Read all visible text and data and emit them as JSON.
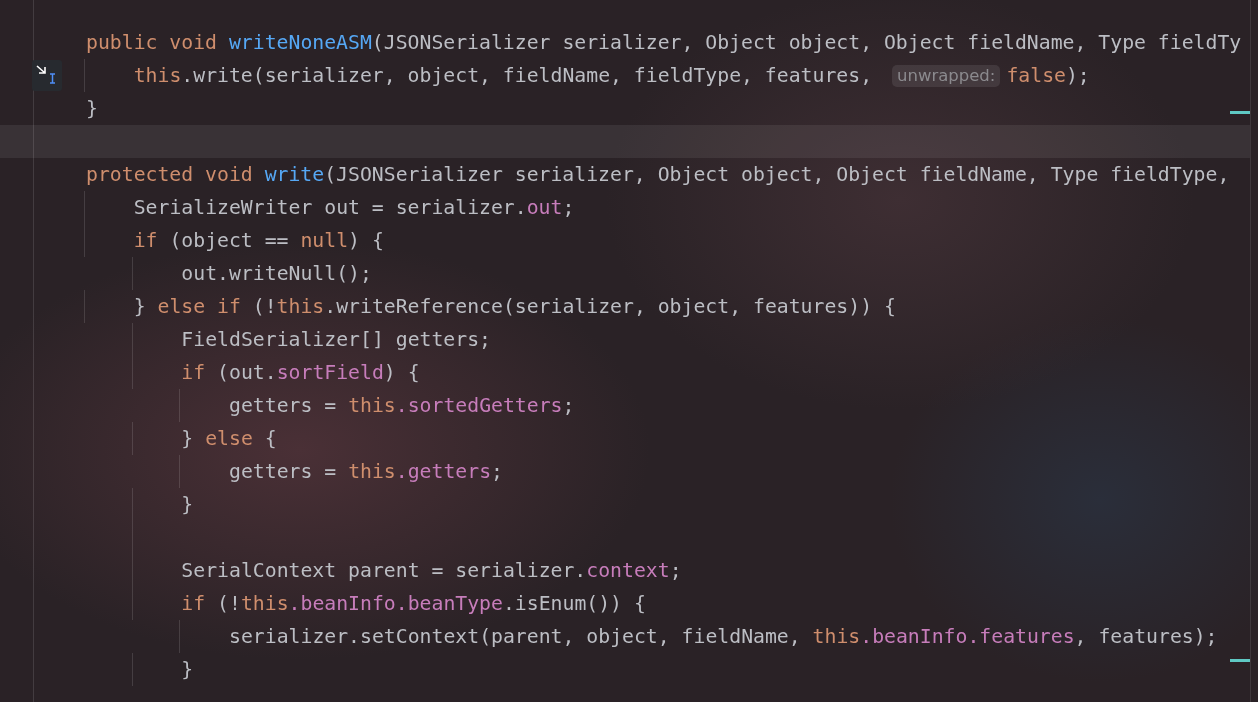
{
  "editor": {
    "lines": [
      {
        "current": false,
        "parts": [
          {
            "kind": "code",
            "tokens": [
              {
                "text": "public void ",
                "kind": "keyword"
              },
              {
                "text": "writeNoneASM",
                "kind": "method"
              },
              {
                "text": "(JSONSerializer serializer, Object object, Object fieldName, Type fieldTy",
                "kind": "plain"
              }
            ]
          }
        ],
        "children": [
          {
            "current": false,
            "gutter_icon": true,
            "parts": [
              {
                "kind": "code",
                "tokens": [
                  {
                    "text": "this",
                    "kind": "keyword"
                  },
                  {
                    "text": ".write(serializer, object, fieldName, fieldType, features, ",
                    "kind": "plain"
                  }
                ]
              },
              {
                "kind": "hint",
                "text": "unwrapped:"
              },
              {
                "kind": "code",
                "tokens": [
                  {
                    "text": "false",
                    "kind": "keyword"
                  },
                  {
                    "text": ");",
                    "kind": "plain"
                  }
                ]
              }
            ]
          }
        ]
      },
      {
        "current": false,
        "parts": [
          {
            "kind": "code",
            "tokens": [
              {
                "text": "}",
                "kind": "plain"
              }
            ]
          }
        ]
      },
      {
        "current": true
      },
      {
        "current": false,
        "parts": [
          {
            "kind": "code",
            "tokens": [
              {
                "text": "protected void ",
                "kind": "keyword"
              },
              {
                "text": "write",
                "kind": "method"
              },
              {
                "text": "(JSONSerializer serializer, Object object, Object fieldName, Type fieldType,",
                "kind": "plain"
              }
            ]
          }
        ],
        "children": [
          {
            "current": false,
            "parts": [
              {
                "kind": "code",
                "tokens": [
                  {
                    "text": "SerializeWriter out = serializer.",
                    "kind": "plain"
                  },
                  {
                    "text": "out",
                    "kind": "field"
                  },
                  {
                    "text": ";",
                    "kind": "plain"
                  }
                ]
              }
            ]
          },
          {
            "current": false,
            "parts": [
              {
                "kind": "code",
                "tokens": [
                  {
                    "text": "if",
                    "kind": "keyword"
                  },
                  {
                    "text": " (object == ",
                    "kind": "plain"
                  },
                  {
                    "text": "null",
                    "kind": "keyword"
                  },
                  {
                    "text": ") {",
                    "kind": "plain"
                  }
                ]
              }
            ],
            "children": [
              {
                "current": false,
                "parts": [
                  {
                    "kind": "code",
                    "tokens": [
                      {
                        "text": "out.writeNull();",
                        "kind": "plain"
                      }
                    ]
                  }
                ]
              }
            ]
          },
          {
            "current": false,
            "parts": [
              {
                "kind": "code",
                "tokens": [
                  {
                    "text": "} ",
                    "kind": "plain"
                  },
                  {
                    "text": "else if",
                    "kind": "keyword"
                  },
                  {
                    "text": " (!",
                    "kind": "plain"
                  },
                  {
                    "text": "this",
                    "kind": "keyword"
                  },
                  {
                    "text": ".writeReference(serializer, object, features)) {",
                    "kind": "plain"
                  }
                ]
              }
            ],
            "children": [
              {
                "current": false,
                "parts": [
                  {
                    "kind": "code",
                    "tokens": [
                      {
                        "text": "FieldSerializer[] getters;",
                        "kind": "plain"
                      }
                    ]
                  }
                ]
              },
              {
                "current": false,
                "parts": [
                  {
                    "kind": "code",
                    "tokens": [
                      {
                        "text": "if",
                        "kind": "keyword"
                      },
                      {
                        "text": " (out.",
                        "kind": "plain"
                      },
                      {
                        "text": "sortField",
                        "kind": "field"
                      },
                      {
                        "text": ") {",
                        "kind": "plain"
                      }
                    ]
                  }
                ],
                "children": [
                  {
                    "current": false,
                    "parts": [
                      {
                        "kind": "code",
                        "tokens": [
                          {
                            "text": "getters = ",
                            "kind": "plain"
                          },
                          {
                            "text": "this",
                            "kind": "keyword"
                          },
                          {
                            "text": ".sortedGetters",
                            "kind": "field"
                          },
                          {
                            "text": ";",
                            "kind": "plain"
                          }
                        ]
                      }
                    ]
                  }
                ]
              },
              {
                "current": false,
                "parts": [
                  {
                    "kind": "code",
                    "tokens": [
                      {
                        "text": "} ",
                        "kind": "plain"
                      },
                      {
                        "text": "else",
                        "kind": "keyword"
                      },
                      {
                        "text": " {",
                        "kind": "plain"
                      }
                    ]
                  }
                ],
                "children": [
                  {
                    "current": false,
                    "parts": [
                      {
                        "kind": "code",
                        "tokens": [
                          {
                            "text": "getters = ",
                            "kind": "plain"
                          },
                          {
                            "text": "this",
                            "kind": "keyword"
                          },
                          {
                            "text": ".getters",
                            "kind": "field"
                          },
                          {
                            "text": ";",
                            "kind": "plain"
                          }
                        ]
                      }
                    ]
                  }
                ]
              },
              {
                "current": false,
                "parts": [
                  {
                    "kind": "code",
                    "tokens": [
                      {
                        "text": "}",
                        "kind": "plain"
                      }
                    ]
                  }
                ]
              },
              {
                "current": false
              },
              {
                "current": false,
                "parts": [
                  {
                    "kind": "code",
                    "tokens": [
                      {
                        "text": "SerialContext parent = serializer.",
                        "kind": "plain"
                      },
                      {
                        "text": "context",
                        "kind": "field"
                      },
                      {
                        "text": ";",
                        "kind": "plain"
                      }
                    ]
                  }
                ]
              },
              {
                "current": false,
                "parts": [
                  {
                    "kind": "code",
                    "tokens": [
                      {
                        "text": "if",
                        "kind": "keyword"
                      },
                      {
                        "text": " (!",
                        "kind": "plain"
                      },
                      {
                        "text": "this",
                        "kind": "keyword"
                      },
                      {
                        "text": ".beanInfo.beanType",
                        "kind": "field"
                      },
                      {
                        "text": ".isEnum()) {",
                        "kind": "plain"
                      }
                    ]
                  }
                ],
                "children": [
                  {
                    "current": false,
                    "parts": [
                      {
                        "kind": "code",
                        "tokens": [
                          {
                            "text": "serializer.setContext(parent, object, fieldName, ",
                            "kind": "plain"
                          },
                          {
                            "text": "this",
                            "kind": "keyword"
                          },
                          {
                            "text": ".beanInfo.features",
                            "kind": "field"
                          },
                          {
                            "text": ", features);",
                            "kind": "plain"
                          }
                        ]
                      }
                    ]
                  }
                ]
              },
              {
                "current": false,
                "parts": [
                  {
                    "kind": "code",
                    "tokens": [
                      {
                        "text": "}",
                        "kind": "plain"
                      }
                    ]
                  }
                ]
              }
            ]
          }
        ]
      }
    ]
  }
}
